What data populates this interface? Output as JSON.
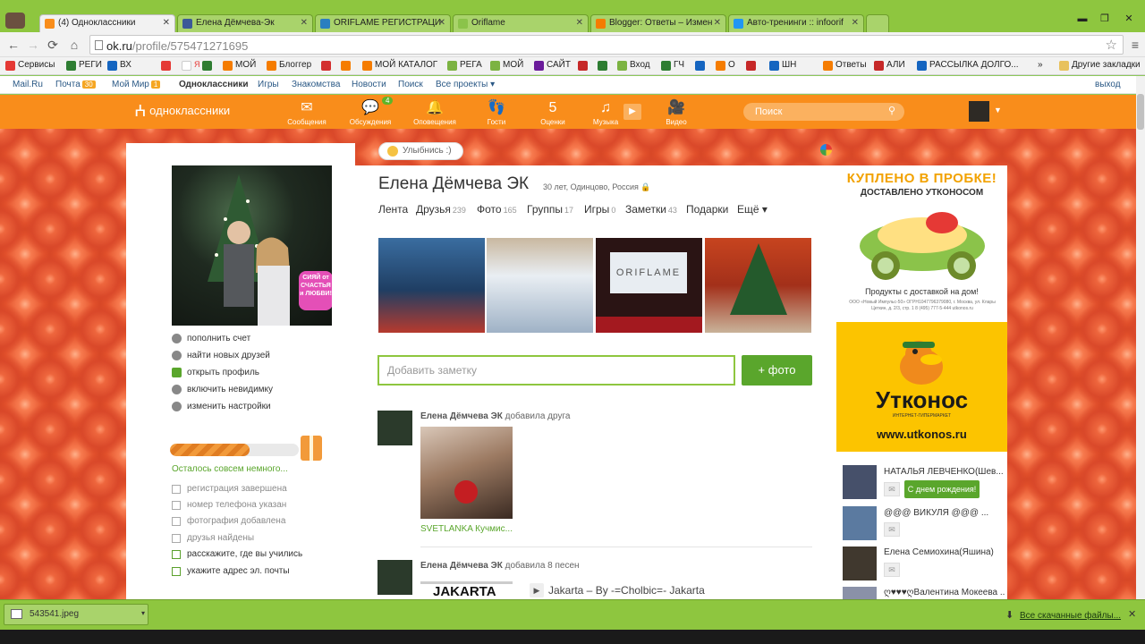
{
  "browser": {
    "tabs": [
      {
        "label": "(4) Одноклассники",
        "icon_color": "#f98d1b",
        "active": true
      },
      {
        "label": "Елена Дёмчева-Эк",
        "icon_color": "#3b5998"
      },
      {
        "label": "ORIFLAME РЕГИСТРАЦИ",
        "icon_color": "#2a7fc0"
      },
      {
        "label": "Oriflame",
        "icon_color": "#8bc34a"
      },
      {
        "label": "Blogger: Ответы – Измен",
        "icon_color": "#f57c00"
      },
      {
        "label": "Авто-тренинги :: infoorif",
        "icon_color": "#2196f3"
      }
    ],
    "window_controls": {
      "minimize": "▬",
      "maximize": "❐",
      "close": "✕"
    },
    "url": {
      "host": "ok.ru",
      "path": "/profile/575471271695"
    },
    "bookmarks": [
      {
        "label": "Сервисы",
        "icon_color": "#e53935"
      },
      {
        "label": "РЕГИ",
        "icon_color": "#2e7d32"
      },
      {
        "label": "ВХ",
        "icon_color": "#1565c0"
      },
      {
        "label": "",
        "icon_color": "#e53935"
      },
      {
        "label": "Я",
        "icon_color": "#fff"
      },
      {
        "label": "",
        "icon_color": "#2e7d32"
      },
      {
        "label": "МОЙ",
        "icon_color": "#f57c00"
      },
      {
        "label": "Блоггер",
        "icon_color": "#f57c00"
      },
      {
        "label": "",
        "icon_color": "#d32f2f"
      },
      {
        "label": "МОЙ КАТАЛОГ",
        "icon_color": "#f57c00"
      },
      {
        "label": "РЕГА",
        "icon_color": "#7cb342"
      },
      {
        "label": "МОЙ",
        "icon_color": "#7cb342"
      },
      {
        "label": "САЙТ",
        "icon_color": "#6a1b9a"
      },
      {
        "label": "",
        "icon_color": "#c62828"
      },
      {
        "label": "",
        "icon_color": "#2e7d32"
      },
      {
        "label": "Вход",
        "icon_color": "#7cb342"
      },
      {
        "label": "ГЧ",
        "icon_color": "#2e7d32"
      },
      {
        "label": "",
        "icon_color": "#1565c0"
      },
      {
        "label": "О",
        "icon_color": "#f57c00"
      },
      {
        "label": "",
        "icon_color": "#c62828"
      },
      {
        "label": "ШН",
        "icon_color": "#1565c0"
      },
      {
        "label": "Ответы",
        "icon_color": "#f57c00"
      },
      {
        "label": "АЛИ",
        "icon_color": "#c62828"
      },
      {
        "label": "РАССЫЛКА ДОЛГО...",
        "icon_color": "#1565c0"
      }
    ],
    "bookmarks_more": "»",
    "other_bookmarks": "Другие закладки"
  },
  "portal": {
    "mailru": "Mail.Ru",
    "mail": "Почта",
    "mail_count": "30",
    "myworld": "Мой Мир",
    "myworld_count": "1",
    "ok": "Одноклассники",
    "games": "Игры",
    "dating": "Знакомства",
    "news": "Новости",
    "search": "Поиск",
    "all": "Все проекты",
    "exit": "выход"
  },
  "okheader": {
    "logo": "одноклассники",
    "nav": [
      {
        "label": "Сообщения",
        "icon": "envelope-icon",
        "glyph": "✉"
      },
      {
        "label": "Обсуждения",
        "icon": "chat-icon",
        "glyph": "💬",
        "badge": "4"
      },
      {
        "label": "Оповещения",
        "icon": "bell-icon",
        "glyph": "🔔"
      },
      {
        "label": "Гости",
        "icon": "footprints-icon",
        "glyph": "👣"
      },
      {
        "label": "Оценки",
        "icon": "rating-icon",
        "glyph": "5"
      },
      {
        "label": "Музыка",
        "icon": "music-icon",
        "glyph": "♫"
      },
      {
        "label": "Видео",
        "icon": "video-icon",
        "glyph": "🎥"
      }
    ],
    "search_placeholder": "Поиск"
  },
  "left": {
    "menu": [
      {
        "label": "пополнить счет",
        "icon": "coin-icon"
      },
      {
        "label": "найти новых друзей",
        "icon": "person-icon"
      },
      {
        "label": "открыть профиль",
        "icon": "lock-icon"
      },
      {
        "label": "включить невидимку",
        "icon": "invisible-icon"
      },
      {
        "label": "изменить настройки",
        "icon": "gear-icon"
      }
    ],
    "progress_label": "Осталось совсем немного...",
    "progress_fraction": 0.62,
    "checklist": [
      {
        "label": "регистрация завершена",
        "done": true
      },
      {
        "label": "номер телефона указан",
        "done": true
      },
      {
        "label": "фотография добавлена",
        "done": true
      },
      {
        "label": "друзья найдены",
        "done": true
      },
      {
        "label": "расскажите, где вы учились",
        "done": false
      },
      {
        "label": "укажите адрес эл. почты",
        "done": false
      }
    ],
    "sticker": "СИЯЙ от СЧАСТЬЯ и ЛЮБВИ!"
  },
  "profile": {
    "smile_btn": "Улыбнись :)",
    "name": "Елена Дёмчева ЭК",
    "meta": "30 лет, Одинцово, Россия",
    "tabs": [
      {
        "label": "Лента",
        "count": ""
      },
      {
        "label": "Друзья",
        "count": "239"
      },
      {
        "label": "Фото",
        "count": "165"
      },
      {
        "label": "Группы",
        "count": "17"
      },
      {
        "label": "Игры",
        "count": "0"
      },
      {
        "label": "Заметки",
        "count": "43"
      },
      {
        "label": "Подарки",
        "count": ""
      },
      {
        "label": "Ещё ▾",
        "count": ""
      }
    ],
    "photo_colors": [
      "#2c5a8a",
      "#d8dee6",
      "#3a1e1e",
      "#b8311f"
    ],
    "oriflame_text": "ORIFLAME",
    "note_placeholder": "Добавить заметку",
    "photo_btn": "+ фото"
  },
  "feed": [
    {
      "author": "Елена Дёмчева ЭК",
      "action": "добавила друга",
      "friend": "SVETLANKA Кучмис..."
    },
    {
      "author": "Елена Дёмчева ЭК",
      "action": "добавила 8 песен",
      "img_text": "JAKARTA",
      "song": "Jakarta – By -=Cholbic=- Jakarta"
    }
  ],
  "ad": {
    "headline1": "КУПЛЕНО В ПРОБКЕ!",
    "headline2": "ДОСТАВЛЕНО УТКОНОСОМ",
    "tagline": "Продукты с доставкой на дом!",
    "legal": "ООО «Новый Импульс-50» ОГРН1047796379080, г. Москва, ул. Клары Цеткин, д. 2/3, стр. 1 8 (495) 777-5-444 utkonos.ru",
    "brand": "Утконос",
    "brand_sub": "ИНТЕРНЕТ-ГИПЕРМАРКЕТ",
    "url": "www.utkonos.ru"
  },
  "friends": [
    {
      "name": "НАТАЛЬЯ ЛЕВЧЕНКО(Шев...",
      "bday": "С днем рождения!"
    },
    {
      "name": "@@@ ВИКУЛЯ @@@ ..."
    },
    {
      "name": "Елена Семиохина(Яшина)"
    },
    {
      "name": "ღ♥♥♥ღВалентина Мокеева ..."
    }
  ],
  "downloads": {
    "file": "543541.jpeg",
    "all": "Все скачанные файлы..."
  }
}
